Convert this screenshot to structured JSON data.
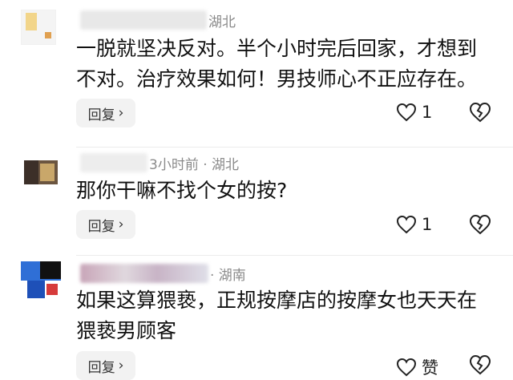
{
  "comments": [
    {
      "meta_text": "湖北",
      "content": "一脱就坚决反对。半个小时完后回家，才想到不对。治疗效果如何！男技师心不正应存在。",
      "reply_label": "回复",
      "like_count": "1"
    },
    {
      "meta_text": "3小时前 · 湖北",
      "content": "那你干嘛不找个女的按?",
      "reply_label": "回复",
      "like_count": "1"
    },
    {
      "meta_text": "· 湖南",
      "content": "如果这算猥亵，正规按摩店的按摩女也天天在猥亵男顾客",
      "reply_label": "回复",
      "like_count": "赞"
    }
  ],
  "icons": {
    "reply_chevron": "chevron-right-icon",
    "like": "heart-outline-icon",
    "dislike": "broken-heart-icon"
  },
  "colors": {
    "text": "#111111",
    "meta": "#8a8a8a",
    "reply_bg": "#f2f2f2",
    "divider": "#ececec"
  }
}
